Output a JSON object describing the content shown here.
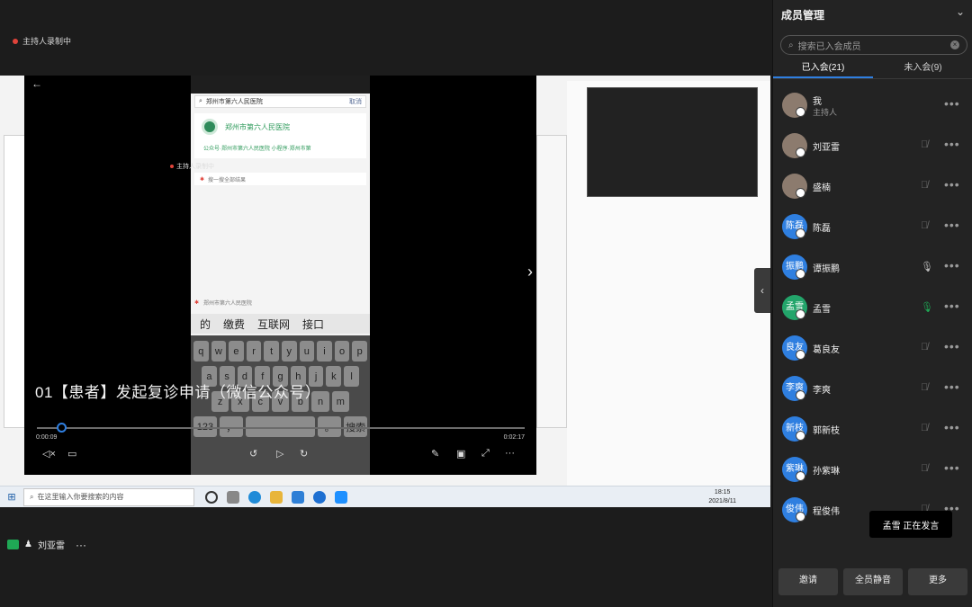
{
  "stage": {
    "recording_label": "主持人录制中",
    "bottom_user_name": "刘亚雷",
    "bottom_more": "···"
  },
  "player": {
    "title": "01【患者】发起复诊申请（微信公众号）",
    "time_current": "0:00:09",
    "time_total": "0:02:17",
    "progress": 0.05,
    "recording_label": "主持人录制中",
    "phone": {
      "search_value": "郑州市第六人民医院",
      "search_cancel": "取消",
      "result_name": "郑州市第六人民医院",
      "result_desc": "公众号·郑州市第六人民医院 小程序·郑州市第",
      "more_row": "搜一搜全部结果",
      "suggest_row": "郑州市第六人民医院",
      "candidates": [
        "的",
        "缴费",
        "互联网",
        "接口"
      ],
      "keys_row1": [
        "q",
        "w",
        "e",
        "r",
        "t",
        "y",
        "u",
        "i",
        "o",
        "p"
      ],
      "keys_row2": [
        "a",
        "s",
        "d",
        "f",
        "g",
        "h",
        "j",
        "k",
        "l"
      ],
      "keys_row3": [
        "z",
        "x",
        "c",
        "v",
        "b",
        "n",
        "m"
      ],
      "keys_row4": [
        "123",
        "，",
        "",
        "。",
        "搜索"
      ]
    }
  },
  "taskbar": {
    "search_placeholder": "在这里输入你要搜索的内容",
    "time": "18:15",
    "date": "2021/8/11"
  },
  "panel": {
    "title": "成员管理",
    "search_placeholder": "搜索已入会成员",
    "tab_joined": "已入会(21)",
    "tab_not_joined": "未入会(9)",
    "members": [
      {
        "name": "我",
        "sub": "主持人",
        "avatar": "",
        "mic": "none"
      },
      {
        "name": "刘亚雷",
        "sub": "",
        "avatar": "",
        "mic": "muted"
      },
      {
        "name": "盛楠",
        "sub": "",
        "avatar": "",
        "mic": "muted"
      },
      {
        "name": "陈磊",
        "sub": "",
        "avatar": "陈磊",
        "mic": "muted"
      },
      {
        "name": "谭振鹏",
        "sub": "",
        "avatar": "振鹏",
        "mic": "on"
      },
      {
        "name": "孟雪",
        "sub": "",
        "avatar": "孟雪",
        "mic": "speaking"
      },
      {
        "name": "葛良友",
        "sub": "",
        "avatar": "良友",
        "mic": "muted"
      },
      {
        "name": "李爽",
        "sub": "",
        "avatar": "李爽",
        "mic": "muted"
      },
      {
        "name": "郭新枝",
        "sub": "",
        "avatar": "新枝",
        "mic": "muted"
      },
      {
        "name": "孙紫琳",
        "sub": "",
        "avatar": "紫琳",
        "mic": "muted"
      },
      {
        "name": "程俊伟",
        "sub": "",
        "avatar": "俊伟",
        "mic": "muted"
      }
    ],
    "speaking_toast": "孟雪  正在发言",
    "buttons": {
      "invite": "邀请",
      "mute_all": "全员静音",
      "more": "更多"
    },
    "colors": {
      "accent": "#2f7fe0",
      "speaking": "#1fa855"
    }
  }
}
